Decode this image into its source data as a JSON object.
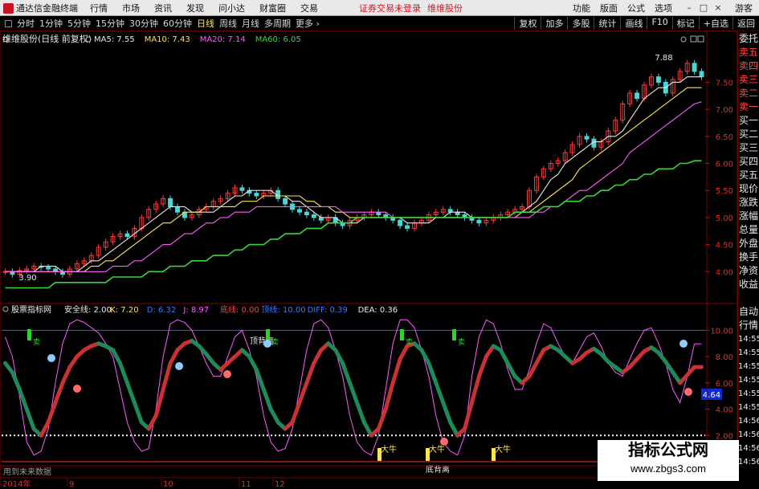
{
  "menubar": {
    "app_title": "通达信金融终端",
    "items": [
      "行情",
      "市场",
      "资讯",
      "发现",
      "问小达",
      "财富圈",
      "交易"
    ],
    "warning": "证券交易未登录",
    "warning_stock": "维维股份",
    "right_items": [
      "功能",
      "版面",
      "公式",
      "选项"
    ],
    "guest_label": "游客"
  },
  "periods": {
    "items": [
      "分时",
      "1分钟",
      "5分钟",
      "15分钟",
      "30分钟",
      "60分钟",
      "日线",
      "周线",
      "月线",
      "多周期",
      "更多"
    ],
    "active": "日线",
    "tools": [
      "复权",
      "加多",
      "多股",
      "统计",
      "画线",
      "F10",
      "标记",
      "+自选",
      "返回"
    ]
  },
  "main_panel": {
    "stock_label": "维维股份(日线 前复权)",
    "ma": [
      {
        "label": "MA5: 7.55",
        "color": "#e8e8e8"
      },
      {
        "label": "MA10: 7.43",
        "color": "#ffe45a"
      },
      {
        "label": "MA20: 7.14",
        "color": "#ff5cff"
      },
      {
        "label": "MA60: 6.05",
        "color": "#3ad63a"
      }
    ],
    "high_label": "7.88",
    "low_label": "3.90"
  },
  "indicator_panel": {
    "name_label": "股票指标网",
    "values": [
      {
        "label": "安全线: 2.00",
        "color": "#e8e8e8"
      },
      {
        "label": "K: 7.20",
        "color": "#ffe45a"
      },
      {
        "label": "D: 6.32",
        "color": "#3a7bff"
      },
      {
        "label": "J: 8.97",
        "color": "#ff5cff"
      },
      {
        "label": "底线: 0.00",
        "color": "#ff4040"
      },
      {
        "label": "顶线: 10.00",
        "color": "#3a7bff"
      },
      {
        "label": "DIFF: 0.39",
        "color": "#3a7bff"
      },
      {
        "label": "DEA: 0.36",
        "color": "#e8e8e8"
      }
    ],
    "annotations": {
      "top_divergence": "顶背离",
      "bottom_divergence": "底背离",
      "bull": "大牛",
      "sell": "卖"
    },
    "current_value": "4.64"
  },
  "sidebar": {
    "items": [
      "委托",
      "卖五",
      "卖四",
      "卖三",
      "卖二",
      "卖一",
      "买一",
      "买二",
      "买三",
      "买四",
      "买五",
      "现价",
      "涨跌",
      "涨幅",
      "总量",
      "外盘",
      "换手",
      "净资",
      "收益",
      "",
      "自动",
      "行情",
      "14:55",
      "14:55",
      "14:55",
      "14:55",
      "14:55",
      "14:55",
      "14:56",
      "14:56",
      "14:56",
      "14:56"
    ]
  },
  "footer": {
    "hint": "用到未来数据",
    "date_labels": [
      "2014年",
      "9",
      "10",
      "11",
      "12"
    ]
  },
  "watermark": {
    "title": "指标公式网",
    "url": "www.zbgs3.com"
  },
  "chart_data": [
    {
      "type": "candlestick",
      "title": "维维股份(日线 前复权)",
      "ylim": [
        3.5,
        8.1
      ],
      "y_ticks": [
        4.0,
        4.5,
        5.0,
        5.5,
        6.0,
        6.5,
        7.0,
        7.5
      ],
      "close": [
        4.0,
        3.95,
        4.02,
        4.05,
        4.1,
        4.08,
        4.05,
        4.0,
        3.95,
        4.05,
        4.15,
        4.2,
        4.3,
        4.45,
        4.55,
        4.65,
        4.7,
        4.65,
        4.8,
        5.0,
        5.15,
        5.25,
        5.35,
        5.2,
        5.1,
        5.0,
        5.05,
        5.15,
        5.2,
        5.3,
        5.35,
        5.45,
        5.55,
        5.5,
        5.45,
        5.4,
        5.45,
        5.5,
        5.35,
        5.25,
        5.15,
        5.1,
        5.05,
        5.0,
        4.95,
        5.0,
        4.9,
        4.85,
        4.95,
        5.0,
        5.05,
        5.1,
        5.05,
        5.0,
        4.95,
        4.85,
        4.8,
        4.9,
        4.95,
        5.05,
        5.1,
        5.15,
        5.1,
        5.05,
        5.0,
        4.95,
        4.9,
        4.95,
        5.0,
        5.05,
        5.1,
        5.15,
        5.2,
        5.5,
        5.75,
        5.9,
        6.0,
        6.05,
        6.2,
        6.35,
        6.5,
        6.45,
        6.3,
        6.4,
        6.6,
        6.8,
        7.1,
        7.3,
        7.2,
        7.45,
        7.6,
        7.5,
        7.3,
        7.55,
        7.7,
        7.85,
        7.7,
        7.6
      ],
      "ma_series": [
        {
          "name": "MA5",
          "color": "#e8e8e8",
          "values": [
            4.0,
            4.0,
            4.0,
            4.0,
            4.0,
            4.1,
            4.1,
            4.1,
            4.0,
            4.0,
            4.0,
            4.1,
            4.2,
            4.2,
            4.3,
            4.4,
            4.5,
            4.6,
            4.7,
            4.8,
            4.9,
            5.0,
            5.1,
            5.2,
            5.2,
            5.2,
            5.1,
            5.1,
            5.1,
            5.1,
            5.2,
            5.3,
            5.4,
            5.4,
            5.5,
            5.5,
            5.5,
            5.5,
            5.4,
            5.4,
            5.3,
            5.3,
            5.2,
            5.1,
            5.0,
            5.0,
            5.0,
            4.9,
            4.9,
            4.9,
            5.0,
            5.0,
            5.0,
            5.0,
            5.0,
            5.0,
            4.9,
            4.9,
            4.9,
            4.9,
            5.0,
            5.0,
            5.1,
            5.1,
            5.1,
            5.0,
            5.0,
            5.0,
            5.0,
            5.0,
            5.0,
            5.1,
            5.1,
            5.2,
            5.3,
            5.5,
            5.7,
            5.8,
            6.0,
            6.1,
            6.2,
            6.3,
            6.4,
            6.4,
            6.5,
            6.5,
            6.6,
            6.8,
            7.0,
            7.2,
            7.3,
            7.4,
            7.4,
            7.5,
            7.5,
            7.6,
            7.6,
            7.6
          ]
        },
        {
          "name": "MA10",
          "color": "#ffe45a",
          "values": [
            4.0,
            4.0,
            4.0,
            4.0,
            4.0,
            4.0,
            4.0,
            4.0,
            4.0,
            4.0,
            4.0,
            4.0,
            4.1,
            4.1,
            4.2,
            4.2,
            4.3,
            4.4,
            4.5,
            4.6,
            4.7,
            4.8,
            4.9,
            4.9,
            5.0,
            5.1,
            5.1,
            5.1,
            5.2,
            5.2,
            5.2,
            5.2,
            5.2,
            5.3,
            5.3,
            5.3,
            5.4,
            5.4,
            5.4,
            5.4,
            5.4,
            5.4,
            5.3,
            5.3,
            5.2,
            5.2,
            5.1,
            5.1,
            5.0,
            5.0,
            5.0,
            5.0,
            5.0,
            5.0,
            5.0,
            5.0,
            5.0,
            5.0,
            5.0,
            5.0,
            5.0,
            5.0,
            5.0,
            5.0,
            5.0,
            5.0,
            5.0,
            5.0,
            5.0,
            5.0,
            5.0,
            5.0,
            5.1,
            5.1,
            5.2,
            5.3,
            5.4,
            5.5,
            5.6,
            5.7,
            5.9,
            6.0,
            6.1,
            6.2,
            6.3,
            6.4,
            6.5,
            6.6,
            6.7,
            6.8,
            6.9,
            7.0,
            7.1,
            7.2,
            7.3,
            7.4,
            7.4,
            7.4
          ]
        },
        {
          "name": "MA20",
          "color": "#ff5cff",
          "values": [
            4.0,
            4.0,
            4.0,
            4.0,
            4.0,
            4.0,
            4.0,
            4.0,
            4.0,
            4.0,
            4.0,
            4.0,
            4.0,
            4.0,
            4.0,
            4.1,
            4.1,
            4.1,
            4.2,
            4.2,
            4.3,
            4.4,
            4.5,
            4.5,
            4.6,
            4.7,
            4.7,
            4.8,
            4.9,
            4.9,
            5.0,
            5.0,
            5.1,
            5.1,
            5.1,
            5.2,
            5.2,
            5.2,
            5.2,
            5.2,
            5.2,
            5.2,
            5.2,
            5.2,
            5.2,
            5.2,
            5.2,
            5.1,
            5.1,
            5.1,
            5.1,
            5.1,
            5.1,
            5.1,
            5.0,
            5.0,
            5.0,
            5.0,
            5.0,
            5.0,
            5.0,
            5.0,
            5.0,
            5.0,
            5.0,
            5.0,
            5.0,
            5.0,
            5.0,
            5.0,
            5.0,
            5.0,
            5.0,
            5.0,
            5.1,
            5.1,
            5.2,
            5.2,
            5.3,
            5.4,
            5.5,
            5.5,
            5.6,
            5.7,
            5.8,
            5.9,
            6.0,
            6.2,
            6.3,
            6.4,
            6.5,
            6.6,
            6.7,
            6.8,
            6.9,
            7.0,
            7.1,
            7.14
          ]
        },
        {
          "name": "MA60",
          "color": "#3ad63a",
          "values": [
            3.7,
            3.7,
            3.7,
            3.7,
            3.7,
            3.7,
            3.7,
            3.8,
            3.8,
            3.8,
            3.8,
            3.8,
            3.8,
            3.8,
            3.8,
            3.9,
            3.9,
            3.9,
            3.9,
            3.9,
            4.0,
            4.0,
            4.0,
            4.1,
            4.1,
            4.1,
            4.2,
            4.2,
            4.2,
            4.3,
            4.3,
            4.3,
            4.4,
            4.4,
            4.5,
            4.5,
            4.5,
            4.6,
            4.6,
            4.7,
            4.7,
            4.7,
            4.8,
            4.8,
            4.8,
            4.9,
            4.9,
            4.9,
            4.9,
            5.0,
            5.0,
            5.0,
            5.0,
            5.0,
            5.0,
            5.0,
            5.0,
            5.0,
            5.0,
            5.0,
            5.0,
            5.0,
            5.0,
            5.0,
            5.0,
            5.0,
            5.0,
            5.0,
            5.0,
            5.0,
            5.0,
            5.1,
            5.1,
            5.1,
            5.1,
            5.2,
            5.2,
            5.2,
            5.3,
            5.3,
            5.3,
            5.4,
            5.4,
            5.5,
            5.5,
            5.6,
            5.6,
            5.7,
            5.7,
            5.8,
            5.8,
            5.9,
            5.9,
            5.9,
            6.0,
            6.0,
            6.05,
            6.05
          ]
        }
      ]
    },
    {
      "type": "line",
      "title": "股票指标网",
      "ylim": [
        0,
        11
      ],
      "y_ticks": [
        2.0,
        4.0,
        6.0,
        8.0,
        10.0
      ],
      "safe_line": 2.0,
      "top_line": 10.0,
      "bottom_line": 0.0,
      "series": [
        {
          "name": "K",
          "color": "#ffe45a",
          "values": [
            7.5,
            6.8,
            5.5,
            4.0,
            2.5,
            2.0,
            3.0,
            4.5,
            6.0,
            7.2,
            8.0,
            8.5,
            8.8,
            9.0,
            8.8,
            8.5,
            7.5,
            6.0,
            4.5,
            3.0,
            2.5,
            3.5,
            5.5,
            7.5,
            8.5,
            9.0,
            9.2,
            8.8,
            8.2,
            7.5,
            7.0,
            7.5,
            8.0,
            8.5,
            8.0,
            7.0,
            5.5,
            4.0,
            3.0,
            2.5,
            3.0,
            4.5,
            6.0,
            7.5,
            8.5,
            9.0,
            8.5,
            7.5,
            6.0,
            4.5,
            3.0,
            2.0,
            2.5,
            4.0,
            6.0,
            7.8,
            8.8,
            9.0,
            8.5,
            7.5,
            6.0,
            4.5,
            3.0,
            2.0,
            2.5,
            4.5,
            6.5,
            8.0,
            8.8,
            8.5,
            7.5,
            6.5,
            6.0,
            6.5,
            7.5,
            8.5,
            8.8,
            8.5,
            8.0,
            7.5,
            7.8,
            8.3,
            8.6,
            8.2,
            7.6,
            7.2,
            6.8,
            7.2,
            7.8,
            8.4,
            8.7,
            8.3,
            7.6,
            6.8,
            6.0,
            6.6,
            7.2,
            7.2
          ]
        },
        {
          "name": "J",
          "color": "#ff5cff",
          "values": [
            9.5,
            8.0,
            5.0,
            1.5,
            0.5,
            0.8,
            2.5,
            6.0,
            9.0,
            10.5,
            10.8,
            10.6,
            10.2,
            9.8,
            9.0,
            8.0,
            5.5,
            3.0,
            1.5,
            0.8,
            1.0,
            4.0,
            8.0,
            10.5,
            10.8,
            10.6,
            10.0,
            8.8,
            7.5,
            6.5,
            6.5,
            8.0,
            9.5,
            10.0,
            8.5,
            6.5,
            3.5,
            1.5,
            0.8,
            1.0,
            2.5,
            5.5,
            8.5,
            10.5,
            10.8,
            10.2,
            8.5,
            6.5,
            3.5,
            1.5,
            0.8,
            0.5,
            2.0,
            5.5,
            9.0,
            10.8,
            10.8,
            10.2,
            8.5,
            6.5,
            3.5,
            1.5,
            0.8,
            0.5,
            2.0,
            6.5,
            9.5,
            10.8,
            10.5,
            9.0,
            7.0,
            5.5,
            5.5,
            7.0,
            9.0,
            10.5,
            10.2,
            9.0,
            8.0,
            7.5,
            8.5,
            9.5,
            9.8,
            8.8,
            7.5,
            6.8,
            6.5,
            7.8,
            9.0,
            10.0,
            10.2,
            9.0,
            7.5,
            5.5,
            4.5,
            6.5,
            8.97,
            8.97
          ]
        }
      ]
    }
  ]
}
